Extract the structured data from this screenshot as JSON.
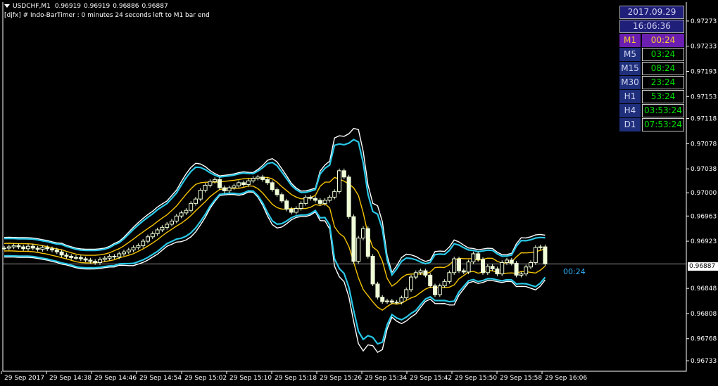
{
  "header": {
    "symbol": "USDCHF,M1",
    "ohlc": [
      "0.96919",
      "0.96919",
      "0.96886",
      "0.96887"
    ],
    "indicator_text": "[djfx] # Indo-BarTimer :  0 minutes 24 seconds left to M1 bar end"
  },
  "time_panel": {
    "date": "2017.09.29",
    "time": "16:06:36",
    "timeframes": [
      {
        "label": "M1",
        "value": "00:24",
        "active": true
      },
      {
        "label": "M5",
        "value": "03:24"
      },
      {
        "label": "M15",
        "value": "08:24"
      },
      {
        "label": "M30",
        "value": "23:24"
      },
      {
        "label": "H1",
        "value": "53:24"
      },
      {
        "label": "H4",
        "value": "03:53:24"
      },
      {
        "label": "D1",
        "value": "07:53:24"
      }
    ]
  },
  "bar_countdown": "00:24",
  "current_price_label": "0.96887",
  "colors": {
    "background": "#000000",
    "bull_candle": "#f0ffd8",
    "bear_candle": "#f0ffd8",
    "band_inner": "#f5c400",
    "band_outer": "#28c8e8",
    "band_outer_edge": "#ffffff",
    "grid": "#c0c0c0",
    "countdown": "#2fb4ff"
  },
  "chart_data": {
    "type": "candlestick",
    "x_tick_labels": [
      "29 Sep 2017",
      "29 Sep 14:38",
      "29 Sep 14:46",
      "29 Sep 14:54",
      "29 Sep 15:02",
      "29 Sep 15:10",
      "29 Sep 15:18",
      "29 Sep 15:26",
      "29 Sep 15:34",
      "29 Sep 15:42",
      "29 Sep 15:50",
      "29 Sep 15:58",
      "29 Sep 16:06"
    ],
    "y_tick_labels": [
      "0.97273",
      "0.97233",
      "0.97193",
      "0.97153",
      "0.97118",
      "0.97078",
      "0.97038",
      "0.97000",
      "0.96963",
      "0.96923",
      "0.96887",
      "0.96848",
      "0.96808",
      "0.96768",
      "0.96733"
    ],
    "y_ticks": [
      0.97273,
      0.97233,
      0.97193,
      0.97153,
      0.97118,
      0.97078,
      0.97038,
      0.97,
      0.96963,
      0.96923,
      0.96848,
      0.96808,
      0.96768,
      0.96733
    ],
    "ylim": [
      0.96723,
      0.97293
    ],
    "current_price": 0.96887,
    "close": [
      0.96912,
      0.96914,
      0.96916,
      0.96914,
      0.96911,
      0.96915,
      0.96912,
      0.9691,
      0.96913,
      0.96911,
      0.96909,
      0.96906,
      0.96901,
      0.96899,
      0.96897,
      0.96897,
      0.96895,
      0.96893,
      0.96891,
      0.96889,
      0.96894,
      0.96896,
      0.96899,
      0.96898,
      0.96903,
      0.96906,
      0.96909,
      0.96913,
      0.96916,
      0.96923,
      0.9693,
      0.96935,
      0.96941,
      0.96945,
      0.9695,
      0.96955,
      0.96963,
      0.96968,
      0.96972,
      0.96983,
      0.9699,
      0.97004,
      0.97012,
      0.97018,
      0.97021,
      0.97008,
      0.97003,
      0.97008,
      0.97011,
      0.97016,
      0.97013,
      0.97019,
      0.97023,
      0.97025,
      0.97021,
      0.97016,
      0.97005,
      0.96997,
      0.96987,
      0.96974,
      0.96969,
      0.96975,
      0.96983,
      0.96993,
      0.96991,
      0.96988,
      0.96983,
      0.96988,
      0.96993,
      0.97002,
      0.97035,
      0.97025,
      0.96962,
      0.96891,
      0.96928,
      0.96943,
      0.96899,
      0.96855,
      0.96834,
      0.96827,
      0.96828,
      0.96826,
      0.96826,
      0.96833,
      0.96846,
      0.96866,
      0.96873,
      0.96876,
      0.96869,
      0.96852,
      0.96838,
      0.96852,
      0.96859,
      0.96873,
      0.96895,
      0.96876,
      0.96874,
      0.9689,
      0.96903,
      0.96894,
      0.96873,
      0.96883,
      0.96879,
      0.96871,
      0.96889,
      0.96893,
      0.96888,
      0.96869,
      0.96871,
      0.96882,
      0.96889,
      0.96913,
      0.96914,
      0.96887
    ]
  }
}
